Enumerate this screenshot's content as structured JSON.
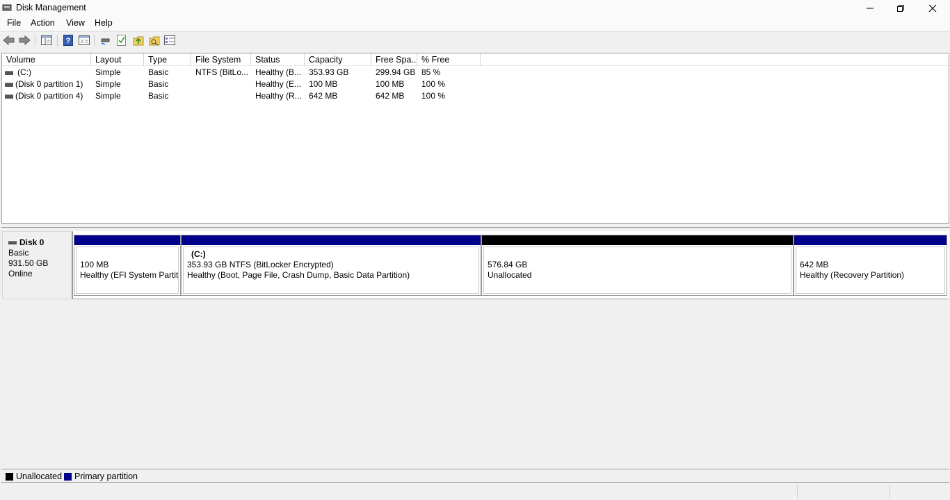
{
  "window": {
    "title": "Disk Management"
  },
  "menu": [
    "File",
    "Action",
    "View",
    "Help"
  ],
  "toolbar": {
    "icons": [
      "back-arrow-icon",
      "forward-arrow-icon",
      "console-tree-icon",
      "help-icon",
      "properties-icon",
      "connect-disk-icon",
      "check-icon",
      "up-folder-icon",
      "search-folder-icon",
      "details-view-icon"
    ]
  },
  "list": {
    "columns": [
      "Volume",
      "Layout",
      "Type",
      "File System",
      "Status",
      "Capacity",
      "Free Spa...",
      "% Free"
    ],
    "rows": [
      {
        "volume": "(C:)",
        "layout": "Simple",
        "type": "Basic",
        "fs": "NTFS (BitLo...",
        "status": "Healthy (B...",
        "capacity": "353.93 GB",
        "free": "299.94 GB",
        "pct": "85 %"
      },
      {
        "volume": "(Disk 0 partition 1)",
        "layout": "Simple",
        "type": "Basic",
        "fs": "",
        "status": "Healthy (E...",
        "capacity": "100 MB",
        "free": "100 MB",
        "pct": "100 %"
      },
      {
        "volume": "(Disk 0 partition 4)",
        "layout": "Simple",
        "type": "Basic",
        "fs": "",
        "status": "Healthy (R...",
        "capacity": "642 MB",
        "free": "642 MB",
        "pct": "100 %"
      }
    ]
  },
  "disk": {
    "name": "Disk 0",
    "type": "Basic",
    "size": "931.50 GB",
    "state": "Online",
    "partitions": [
      {
        "title": "",
        "line1": "100 MB",
        "line2": "Healthy (EFI System Partition)",
        "kind": "primary"
      },
      {
        "title": "(C:)",
        "line1": "353.93 GB NTFS (BitLocker Encrypted)",
        "line2": "Healthy (Boot, Page File, Crash Dump, Basic Data Partition)",
        "kind": "primary"
      },
      {
        "title": "",
        "line1": "576.84 GB",
        "line2": "Unallocated",
        "kind": "unallocated"
      },
      {
        "title": "",
        "line1": "642 MB",
        "line2": "Healthy (Recovery Partition)",
        "kind": "primary"
      }
    ]
  },
  "legend": {
    "unallocated": "Unallocated",
    "primary": "Primary partition"
  },
  "colors": {
    "primary": "#00008b",
    "unallocated": "#000000"
  }
}
